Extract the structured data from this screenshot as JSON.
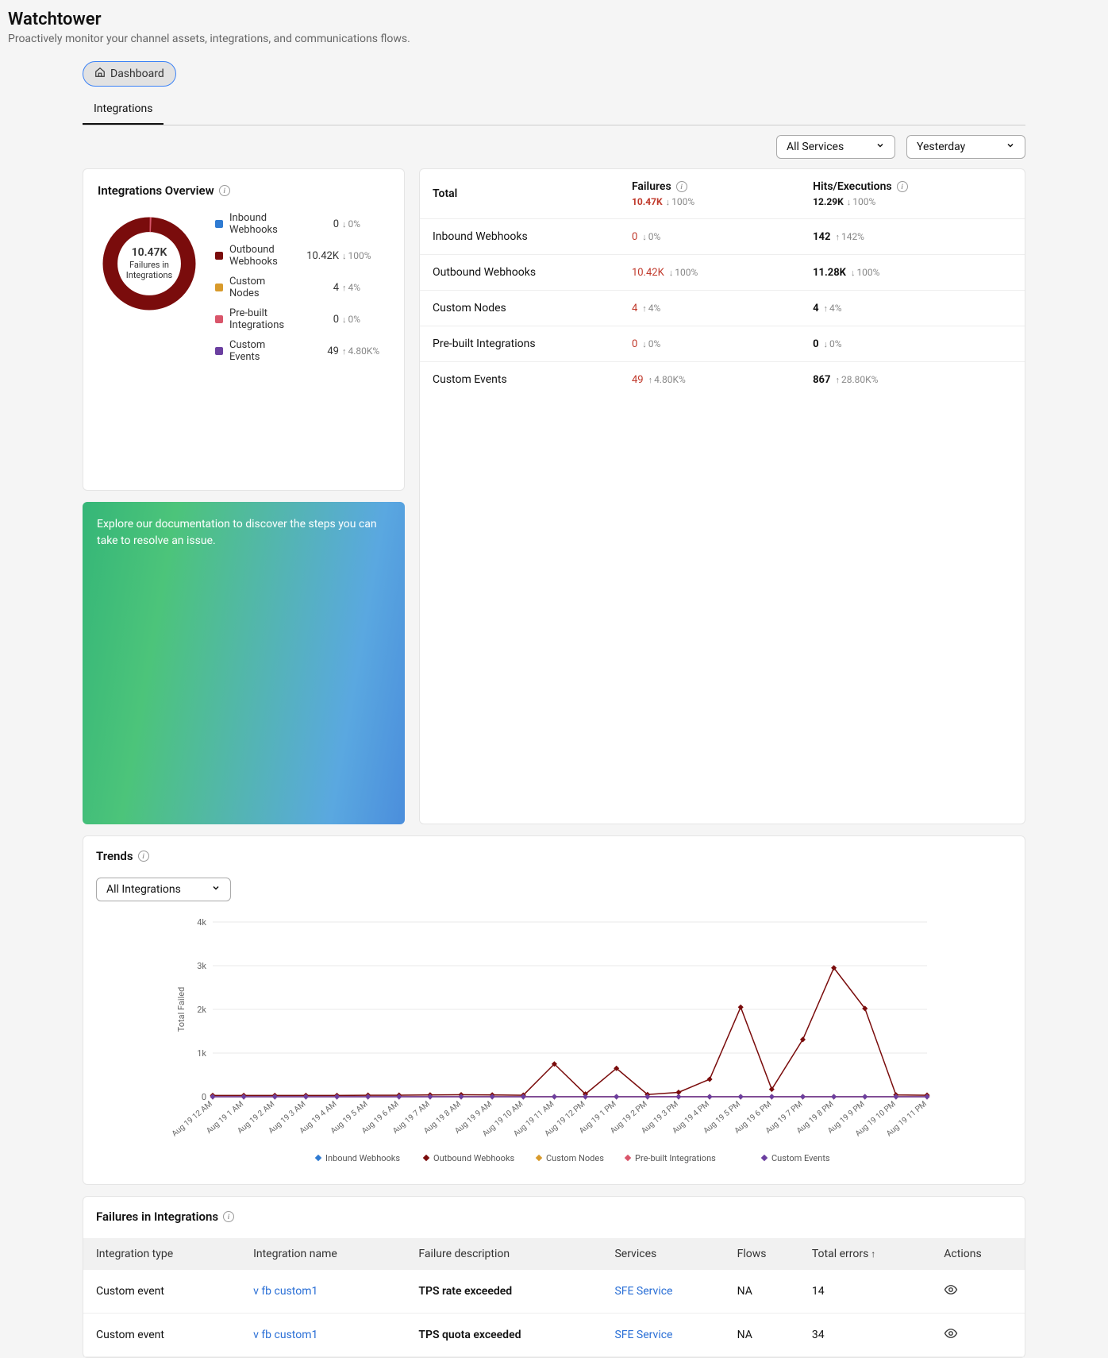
{
  "page": {
    "title": "Watchtower",
    "subtitle": "Proactively monitor your channel assets, integrations, and communications flows."
  },
  "top_pill": {
    "label": "Dashboard"
  },
  "tabs": {
    "active": "Integrations"
  },
  "filters": {
    "service": "All Services",
    "range": "Yesterday"
  },
  "overview": {
    "title": "Integrations Overview",
    "donut_center_value": "10.47K",
    "donut_center_line1": "Failures in",
    "donut_center_line2": "Integrations",
    "items": [
      {
        "label": "Inbound Webhooks",
        "value": "0",
        "dir": "down",
        "pct": "0%",
        "color": "#2f7bd2"
      },
      {
        "label": "Outbound Webhooks",
        "value": "10.42K",
        "dir": "down",
        "pct": "100%",
        "color": "#7a0c0c"
      },
      {
        "label": "Custom Nodes",
        "value": "4",
        "dir": "up",
        "pct": "4%",
        "color": "#d89a2b"
      },
      {
        "label": "Pre-built Integrations",
        "value": "0",
        "dir": "down",
        "pct": "0%",
        "color": "#d9556a"
      },
      {
        "label": "Custom Events",
        "value": "49",
        "dir": "up",
        "pct": "4.80K%",
        "color": "#6b3fa0"
      }
    ]
  },
  "docs_banner": "Explore our documentation to discover the steps you can take to resolve an issue.",
  "totals": {
    "header": {
      "c0": "Total",
      "c1": "Failures",
      "c1_value": "10.47K",
      "c1_dir": "down",
      "c1_pct": "100%",
      "c2": "Hits/Executions",
      "c2_value": "12.29K",
      "c2_dir": "down",
      "c2_pct": "100%"
    },
    "rows": [
      {
        "label": "Inbound Webhooks",
        "fail": "0",
        "fail_dir": "down",
        "fail_pct": "0%",
        "fail_red": true,
        "hits": "142",
        "hits_dir": "up",
        "hits_pct": "142%",
        "hits_bold": true
      },
      {
        "label": "Outbound Webhooks",
        "fail": "10.42K",
        "fail_dir": "down",
        "fail_pct": "100%",
        "fail_red": true,
        "hits": "11.28K",
        "hits_dir": "down",
        "hits_pct": "100%",
        "hits_bold": true
      },
      {
        "label": "Custom Nodes",
        "fail": "4",
        "fail_dir": "up",
        "fail_pct": "4%",
        "fail_red": true,
        "hits": "4",
        "hits_dir": "up",
        "hits_pct": "4%",
        "hits_bold": true
      },
      {
        "label": "Pre-built Integrations",
        "fail": "0",
        "fail_dir": "down",
        "fail_pct": "0%",
        "fail_red": true,
        "hits": "0",
        "hits_dir": "down",
        "hits_pct": "0%",
        "hits_bold": true
      },
      {
        "label": "Custom Events",
        "fail": "49",
        "fail_dir": "up",
        "fail_pct": "4.80K%",
        "fail_red": true,
        "hits": "867",
        "hits_dir": "up",
        "hits_pct": "28.80K%",
        "hits_bold": true
      }
    ]
  },
  "trends": {
    "title": "Trends",
    "select": "All Integrations",
    "legend": [
      "Inbound Webhooks",
      "Outbound Webhooks",
      "Custom Nodes",
      "Pre-built Integrations",
      "Custom Events"
    ]
  },
  "chart_data": {
    "type": "line",
    "title": "",
    "xlabel": "",
    "ylabel": "Total Failed",
    "ylim": [
      0,
      4000
    ],
    "yticks": [
      0,
      1000,
      2000,
      3000,
      4000
    ],
    "ytick_labels": [
      "0",
      "1k",
      "2k",
      "3k",
      "4k"
    ],
    "categories": [
      "Aug 19 12 AM",
      "Aug 19 1 AM",
      "Aug 19 2 AM",
      "Aug 19 3 AM",
      "Aug 19 4 AM",
      "Aug 19 5 AM",
      "Aug 19 6 AM",
      "Aug 19 7 AM",
      "Aug 19 8 AM",
      "Aug 19 9 AM",
      "Aug 19 10 AM",
      "Aug 19 11 AM",
      "Aug 19 12 PM",
      "Aug 19 1 PM",
      "Aug 19 2 PM",
      "Aug 19 3 PM",
      "Aug 19 4 PM",
      "Aug 19 5 PM",
      "Aug 19 6 PM",
      "Aug 19 7 PM",
      "Aug 19 8 PM",
      "Aug 19 9 PM",
      "Aug 19 10 PM",
      "Aug 19 11 PM"
    ],
    "series": [
      {
        "name": "Inbound Webhooks",
        "color": "#2f7bd2",
        "values": [
          0,
          0,
          0,
          0,
          0,
          0,
          0,
          0,
          0,
          0,
          0,
          0,
          0,
          0,
          0,
          0,
          0,
          0,
          0,
          0,
          0,
          0,
          0,
          0
        ]
      },
      {
        "name": "Outbound Webhooks",
        "color": "#7a0c0c",
        "values": [
          30,
          30,
          30,
          30,
          30,
          35,
          35,
          40,
          45,
          40,
          35,
          750,
          60,
          650,
          50,
          100,
          400,
          2050,
          170,
          1310,
          2950,
          2020,
          40,
          35
        ]
      },
      {
        "name": "Custom Nodes",
        "color": "#d89a2b",
        "values": [
          0,
          0,
          0,
          0,
          0,
          0,
          0,
          0,
          0,
          0,
          0,
          0,
          0,
          0,
          0,
          0,
          0,
          0,
          0,
          0,
          0,
          0,
          0,
          0
        ]
      },
      {
        "name": "Pre-built Integrations",
        "color": "#d9556a",
        "values": [
          0,
          0,
          0,
          0,
          0,
          0,
          0,
          0,
          0,
          0,
          0,
          0,
          0,
          0,
          0,
          0,
          0,
          0,
          0,
          0,
          0,
          0,
          0,
          0
        ]
      },
      {
        "name": "Custom Events",
        "color": "#6b3fa0",
        "values": [
          0,
          0,
          0,
          0,
          0,
          0,
          0,
          0,
          0,
          0,
          0,
          0,
          0,
          0,
          0,
          0,
          0,
          0,
          0,
          0,
          0,
          0,
          0,
          0
        ]
      }
    ]
  },
  "failures_table": {
    "title": "Failures in Integrations",
    "columns": [
      "Integration type",
      "Integration name",
      "Failure description",
      "Services",
      "Flows",
      "Total errors",
      "Actions"
    ],
    "sort_col_index": 5,
    "rows": [
      {
        "type": "Custom event",
        "name": "v fb custom1",
        "desc": "TPS rate exceeded",
        "service": "SFE Service",
        "flows": "NA",
        "errors": "14"
      },
      {
        "type": "Custom event",
        "name": "v fb custom1",
        "desc": "TPS quota exceeded",
        "service": "SFE Service",
        "flows": "NA",
        "errors": "34"
      }
    ]
  }
}
